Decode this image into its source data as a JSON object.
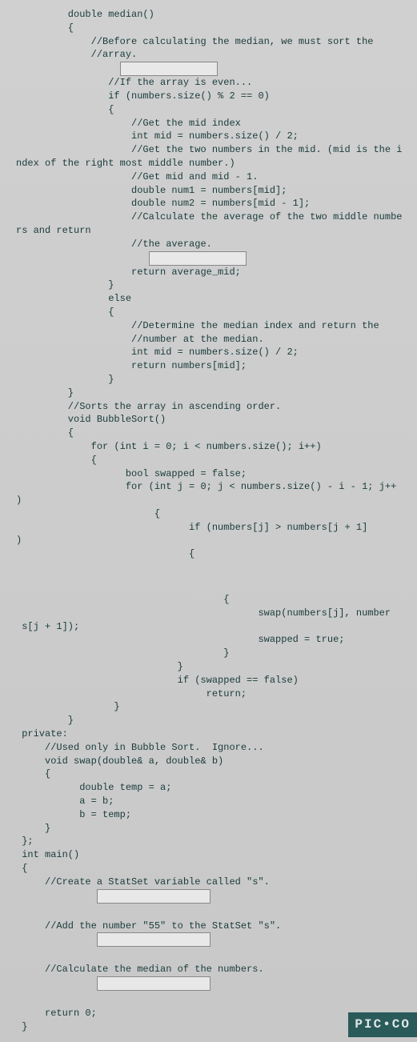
{
  "code": {
    "l1": "         double median()",
    "l2": "         {",
    "l3": "             //Before calculating the median, we must sort the",
    "l4": "             //array.",
    "l5": "",
    "l6": "                //If the array is even...",
    "l7": "                if (numbers.size() % 2 == 0)",
    "l8": "                {",
    "l9": "                    //Get the mid index",
    "l10": "                    int mid = numbers.size() / 2;",
    "l11": "",
    "l12": "                    //Get the two numbers in the mid. (mid is the i",
    "l13": "ndex of the right most middle number.)",
    "l14": "                    //Get mid and mid - 1.",
    "l15": "                    double num1 = numbers[mid];",
    "l16": "                    double num2 = numbers[mid - 1];",
    "l17": "",
    "l18": "                    //Calculate the average of the two middle numbe",
    "l19": "rs and return",
    "l20": "                    //the average.",
    "l21": "",
    "l22": "                    return average_mid;",
    "l23": "                }",
    "l24": "                else",
    "l25": "                {",
    "l26": "                    //Determine the median index and return the",
    "l27": "                    //number at the median.",
    "l28": "                    int mid = numbers.size() / 2;",
    "l29": "                    return numbers[mid];",
    "l30": "                }",
    "l31": "",
    "l32": "         }",
    "l33": "",
    "l34": "         //Sorts the array in ascending order.",
    "l35": "         void BubbleSort()",
    "l36": "         {",
    "l37": "             for (int i = 0; i < numbers.size(); i++)",
    "l38": "             {",
    "l39": "                   bool swapped = false;",
    "l40": "                   for (int j = 0; j < numbers.size() - i - 1; j++",
    "l41": ")",
    "l42": "                        {",
    "l43": "                              if (numbers[j] > numbers[j + 1]",
    "l44": ")",
    "l45": "                              {",
    "l46": "",
    "l47": "                                    {",
    "l48": "                                          swap(numbers[j], number",
    "l49": " s[j + 1]);",
    "l50": "                                          swapped = true;",
    "l51": "                                    }",
    "l52": "                            }",
    "l53": "",
    "l54": "                            if (swapped == false)",
    "l55": "                                 return;",
    "l56": "                 }",
    "l57": "         }",
    "l58": "",
    "l59": " private:",
    "l60": "     //Used only in Bubble Sort.  Ignore...",
    "l61": "     void swap(double& a, double& b)",
    "l62": "     {",
    "l63": "           double temp = a;",
    "l64": "           a = b;",
    "l65": "           b = temp;",
    "l66": "     }",
    "l67": " };",
    "l68": "",
    "l69": " int main()",
    "l70": " {",
    "l71": "     //Create a StatSet variable called \"s\".",
    "l72": "",
    "l73": "     //Add the number \"55\" to the StatSet \"s\".",
    "l74": "",
    "l75": "     //Calculate the median of the numbers.",
    "l76": "",
    "l77": "     return 0;",
    "l78": " }"
  },
  "watermark": "PIC•CO"
}
